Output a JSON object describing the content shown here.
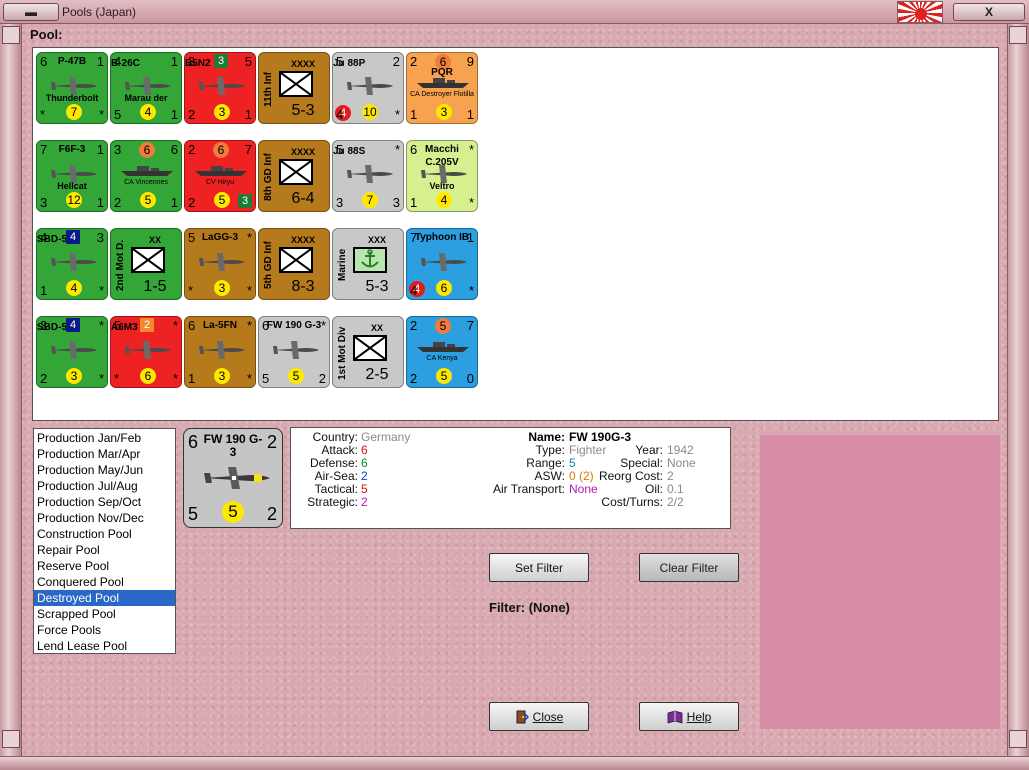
{
  "window": {
    "title": "Pools (Japan)",
    "close_glyph": "X"
  },
  "pool_label": "Pool:",
  "counters": [
    {
      "name": "p47b",
      "type": "air",
      "color": "green",
      "tl": "6",
      "tm": "P-47B",
      "tr": "1",
      "caption": "Thunderbolt",
      "bl": "*",
      "disc": "7",
      "br": "*"
    },
    {
      "name": "b26c",
      "type": "air",
      "color": "green",
      "tl": "4",
      "tm": "",
      "tr": "1",
      "caption": "Marau der",
      "bl": "5",
      "disc": "4",
      "bm": "B-26C",
      "br": "1"
    },
    {
      "name": "b5n2",
      "type": "air",
      "color": "red",
      "tl": "3",
      "sq": "3",
      "sqc": "green",
      "tr": "5",
      "bl": "2",
      "disc": "3",
      "bm": "B5N2",
      "br": "1"
    },
    {
      "name": "11th-inf",
      "type": "land",
      "color": "brown",
      "vert": "11th Inf",
      "ech": "XXXX",
      "str": "5-3"
    },
    {
      "name": "ju88p",
      "type": "air",
      "color": "gray",
      "tl": "5",
      "tr": "2",
      "bl": "4",
      "redDisc": "4",
      "disc": "10",
      "bm": "Ju 88P",
      "br": "*"
    },
    {
      "name": "pqr",
      "type": "ship",
      "color": "orange",
      "tl": "2",
      "disc": "6",
      "tr": "9",
      "caption": "PQR",
      "ship": "CA Destroyer Flotilla",
      "bl": "1",
      "discB": "3",
      "br": "1"
    },
    {
      "name": "f6f3",
      "type": "air",
      "color": "green",
      "tl": "7",
      "tm": "F6F-3",
      "tr": "1",
      "caption": "Hellcat",
      "bl": "3",
      "disc": "12",
      "br": "1"
    },
    {
      "name": "ca-vincennes",
      "type": "ship",
      "color": "green",
      "tl": "3",
      "disc": "6",
      "tr": "6",
      "ship": "CA Vincennes",
      "bl": "2",
      "discB": "5",
      "br": "1"
    },
    {
      "name": "cv-hiryu",
      "type": "ship",
      "color": "red",
      "tl": "2",
      "disc": "6",
      "tr": "7",
      "ship": "CV Hiryu",
      "bl": "2",
      "discB": "5",
      "sqB": "3",
      "br": ""
    },
    {
      "name": "8th-gd-inf",
      "type": "land",
      "color": "brown",
      "vert": "8th GD Inf",
      "ech": "XXXX",
      "str": "6-4"
    },
    {
      "name": "ju88s",
      "type": "air",
      "color": "gray",
      "tl": "5",
      "tr": "*",
      "bl": "3",
      "disc": "7",
      "bm": "Ju 88S",
      "br": "3"
    },
    {
      "name": "macchi",
      "type": "air",
      "color": "lime",
      "tl": "6",
      "tm": "Macchi C.205V",
      "tr": "*",
      "caption": "Veltro",
      "bl": "1",
      "disc": "4",
      "br": "*"
    },
    {
      "name": "sbd5-a",
      "type": "air",
      "color": "green",
      "tl": "4",
      "sq": "4",
      "sqc": "blue",
      "tr": "3",
      "bl": "1",
      "disc": "4",
      "bm": "SBD-5",
      "br": "*"
    },
    {
      "name": "2nd-mot-d",
      "type": "land",
      "color": "green",
      "vert": "2nd Mot D.",
      "ech": "XX",
      "str": "1-5"
    },
    {
      "name": "lagg3",
      "type": "air",
      "color": "brown",
      "tl": "5",
      "tm": "LaGG-3",
      "tr": "*",
      "bl": "*",
      "disc": "3",
      "br": "*"
    },
    {
      "name": "5th-gd-inf",
      "type": "land",
      "color": "brown",
      "vert": "5th GD Inf",
      "ech": "XXXX",
      "str": "8-3"
    },
    {
      "name": "marine",
      "type": "land",
      "color": "gray",
      "vert": "Marine",
      "ech": "XXX",
      "str": "5-3",
      "anchor": true
    },
    {
      "name": "typhoon",
      "type": "air",
      "color": "blue",
      "tl": "7",
      "tm": "Typhoon IB",
      "tr": "1",
      "bl": "4",
      "redDisc": "4",
      "disc": "6",
      "br": "*"
    },
    {
      "name": "sbd5-b",
      "type": "air",
      "color": "green",
      "tl": "3",
      "sq": "4",
      "sqc": "blue",
      "tr": "*",
      "bl": "2",
      "disc": "3",
      "bm": "SBD-5",
      "br": "*"
    },
    {
      "name": "a6m3",
      "type": "air",
      "color": "red",
      "tl": "5",
      "sq": "2",
      "sqc": "orange",
      "tr": "*",
      "bl": "*",
      "disc": "6",
      "bm": "A6M3",
      "br": "*"
    },
    {
      "name": "la5fn",
      "type": "air",
      "color": "brown",
      "tl": "6",
      "tm": "La-5FN",
      "tr": "*",
      "bl": "1",
      "disc": "3",
      "br": "*"
    },
    {
      "name": "fw190g3",
      "type": "air",
      "color": "gray",
      "tl": "6",
      "tm": "FW 190 G-3",
      "tr": "*",
      "bl": "5",
      "disc": "5",
      "br": "2"
    },
    {
      "name": "1st-mot-div",
      "type": "land",
      "color": "gray",
      "vert": "1st Mot Div",
      "ech": "XX",
      "str": "2-5"
    },
    {
      "name": "ca-kenya",
      "type": "ship",
      "color": "blue",
      "tl": "2",
      "disc": "5",
      "tr": "7",
      "ship": "CA Kenya",
      "bl": "2",
      "discB": "5",
      "br": "0"
    }
  ],
  "pool_list": [
    "Production Jan/Feb",
    "Production Mar/Apr",
    "Production May/Jun",
    "Production Jul/Aug",
    "Production Sep/Oct",
    "Production Nov/Dec",
    "Construction Pool",
    "Repair Pool",
    "Reserve Pool",
    "Conquered Pool",
    "Destroyed Pool",
    "Scrapped Pool",
    "Force Pools",
    "Lend Lease Pool"
  ],
  "selected_pool_index": 10,
  "detail_counter": {
    "tl": "6",
    "tm": "FW 190 G-3",
    "tr": "2",
    "bl": "5",
    "disc": "5",
    "br": "2"
  },
  "details": {
    "country_label": "Country:",
    "country": "Germany",
    "attack_label": "Attack:",
    "attack": "6",
    "defense_label": "Defense:",
    "defense": "6",
    "airsea_label": "Air-Sea:",
    "airsea": "2",
    "tactical_label": "Tactical:",
    "tactical": "5",
    "strategic_label": "Strategic:",
    "strategic": "2",
    "name_label": "Name:",
    "name": "FW 190G-3",
    "type_label": "Type:",
    "type": "Fighter",
    "year_label": "Year:",
    "year": "1942",
    "range_label": "Range:",
    "range": "5",
    "special_label": "Special:",
    "special": "None",
    "asw_label": "ASW:",
    "asw": "0 (2)",
    "reorg_label": "Reorg Cost:",
    "reorg": "2",
    "airtransport_label": "Air Transport:",
    "airtransport": "None",
    "oil_label": "Oil:",
    "oil": "0.1",
    "costturns_label": "Cost/Turns:",
    "costturns": "2/2"
  },
  "buttons": {
    "set_filter": "Set Filter",
    "clear_filter": "Clear Filter",
    "close": "Close",
    "help": "Help"
  },
  "filter_text": "Filter: (None)",
  "colors": {
    "green": "#34a537",
    "red": "#ee2222",
    "brown": "#b57a1c",
    "gray": "#c8c8c8",
    "orange": "#f6a24e",
    "lime": "#d7f08f",
    "blue": "#2c9fe0",
    "selection": "#2a68c8"
  }
}
